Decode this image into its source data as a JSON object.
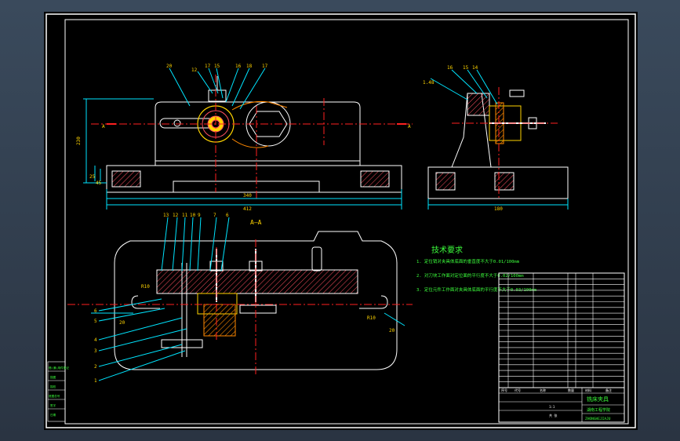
{
  "drawing": {
    "title_text": "技术要求",
    "requirements": [
      "1. 定位销对夹具体底面的垂直度不大于0.01/100mm",
      "2. 对刀块工作面对定位面的平行度不大于0.02/100mm",
      "3. 定位元件工作面对夹具体底面的平行度不大于0.03/100mm"
    ],
    "section_label_top_left": "A",
    "section_label_top_right": "A",
    "section_title": "A—A",
    "dims": {
      "overall_width": "412",
      "base_width": "340",
      "height": "230",
      "side_width": "180",
      "r_left": "R10",
      "r_right": "R10",
      "dim_left_small": "20",
      "dim_right_small": "20",
      "dim_vert_a": "25",
      "dim_vert_b": "45"
    },
    "callouts_top": [
      "20",
      "12",
      "17",
      "15",
      "16",
      "18",
      "17"
    ],
    "callouts_side": [
      "1.48",
      "16",
      "15",
      "14"
    ],
    "callouts_section": [
      "13",
      "12",
      "11",
      "10",
      "9",
      "8",
      "7",
      "6",
      "5",
      "4",
      "3",
      "2",
      "1"
    ],
    "callouts_section_left": [
      "6",
      "5",
      "4",
      "3",
      "2",
      "1"
    ],
    "title_block": {
      "org": "湖南工程学院",
      "name": "铣床夹具",
      "drawing_no": "ZHONGHEJIAJU",
      "ratio": "1:1",
      "sheet": "共 张",
      "header_cols": [
        "序号",
        "代号",
        "名称",
        "数量",
        "材料",
        "备注"
      ]
    },
    "left_strip": [
      "借(通)用件登记",
      "描图",
      "描校",
      "底图总号",
      "签字",
      "日期"
    ]
  },
  "colors": {
    "background": "#000000",
    "outline": "#ffffff",
    "center": "#ff2020",
    "dim": "#00e5ff",
    "accent": "#ffd400",
    "hatch": "#ff5060",
    "section_hatch": "#ff8800",
    "green_text": "#3cff3c"
  }
}
